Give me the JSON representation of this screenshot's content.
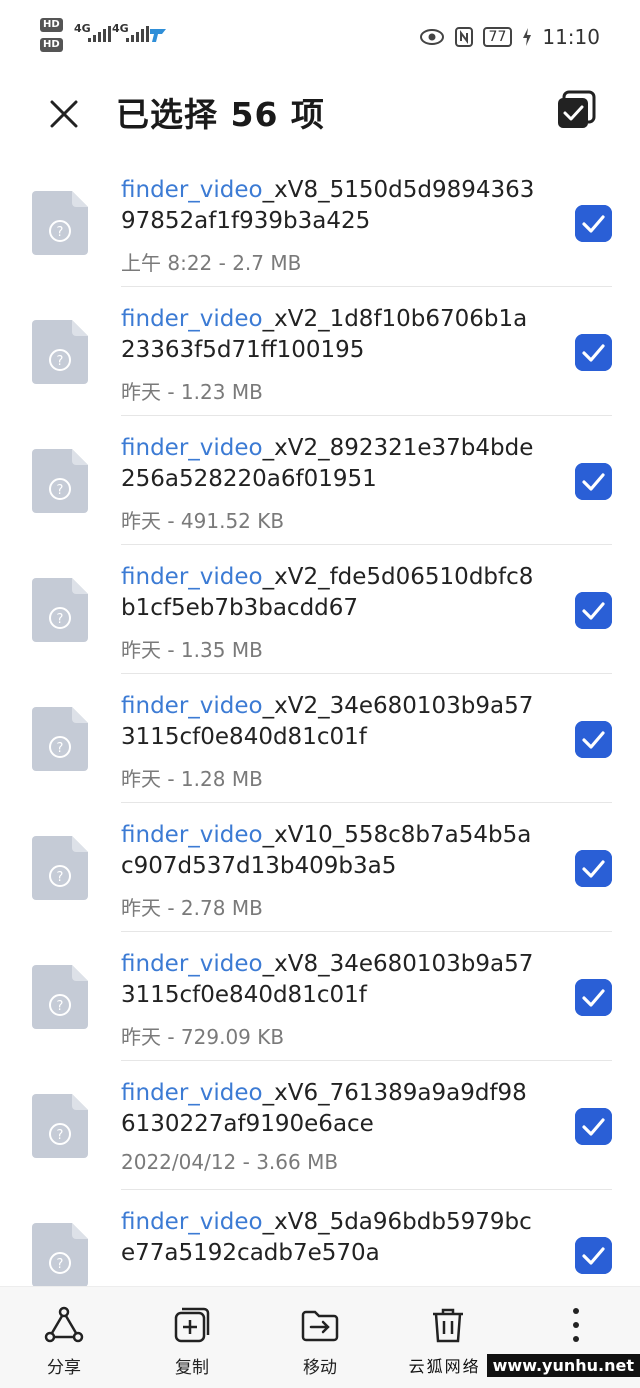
{
  "status_bar": {
    "hd1": "HD",
    "hd2": "HD",
    "net1": "4G",
    "net2": "4G",
    "battery": "77",
    "time": "11:10"
  },
  "header": {
    "title": "已选择 56 项"
  },
  "files": [
    {
      "prefix": "finder_video",
      "rest": "_xV8_5150d5d989436397852af1f939b3a425",
      "meta": "上午 8:22  - 2.7 MB",
      "checked": true
    },
    {
      "prefix": "finder_video",
      "rest": "_xV2_1d8f10b6706b1a23363f5d71ff100195",
      "meta": "昨天 - 1.23 MB",
      "checked": true
    },
    {
      "prefix": "finder_video",
      "rest": "_xV2_892321e37b4bde256a528220a6f01951",
      "meta": "昨天 - 491.52 KB",
      "checked": true
    },
    {
      "prefix": "finder_video",
      "rest": "_xV2_fde5d06510dbfc8b1cf5eb7b3bacdd67",
      "meta": "昨天 - 1.35 MB",
      "checked": true
    },
    {
      "prefix": "finder_video",
      "rest": "_xV2_34e680103b9a573115cf0e840d81c01f",
      "meta": "昨天 - 1.28 MB",
      "checked": true
    },
    {
      "prefix": "finder_video",
      "rest": "_xV10_558c8b7a54b5ac907d537d13b409b3a5",
      "meta": "昨天 - 2.78 MB",
      "checked": true
    },
    {
      "prefix": "finder_video",
      "rest": "_xV8_34e680103b9a573115cf0e840d81c01f",
      "meta": "昨天 - 729.09 KB",
      "checked": true
    },
    {
      "prefix": "finder_video",
      "rest": "_xV6_761389a9a9df986130227af9190e6ace",
      "meta": "2022/04/12 - 3.66 MB",
      "checked": true
    },
    {
      "prefix": "finder_video",
      "rest": "_xV8_5da96bdb5979bce77a5192cadb7e570a",
      "meta": "",
      "checked": true
    }
  ],
  "toolbar": {
    "share": "分享",
    "copy": "复制",
    "move": "移动",
    "delete": "删"
  },
  "watermark": {
    "text": "云狐网络",
    "url": "www.yunhu.net"
  },
  "colors": {
    "accent": "#2a5fd6",
    "link": "#3c7bd4",
    "file_icon": "#c5cbd6"
  }
}
